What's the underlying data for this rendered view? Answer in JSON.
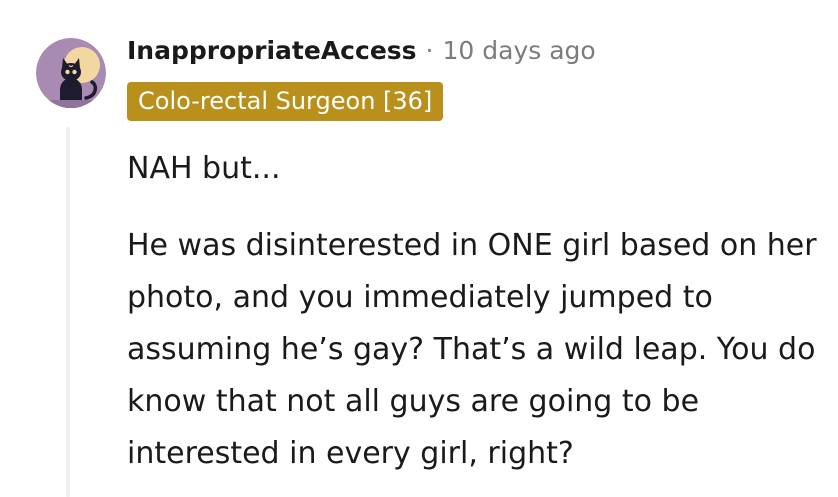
{
  "comment": {
    "author": "InappropriateAccess",
    "separator": "·",
    "timestamp": "10 days ago",
    "flair": {
      "text": "Colo-rectal Surgeon [36]",
      "background_color": "#b8901b",
      "text_color": "#ffffff"
    },
    "avatar": {
      "icon": "cat-avatar-icon",
      "background_color": "#a88ab3"
    },
    "paragraphs": [
      "NAH but...",
      "He was disinterested in ONE girl based on her photo, and you immediately jumped to assuming he’s gay? That’s a wild leap. You do know that not all guys are going to be interested in every girl, right?"
    ]
  },
  "colors": {
    "text": "#1a1a1b",
    "meta": "#7c7c7c",
    "thread_line": "#edeff1"
  }
}
